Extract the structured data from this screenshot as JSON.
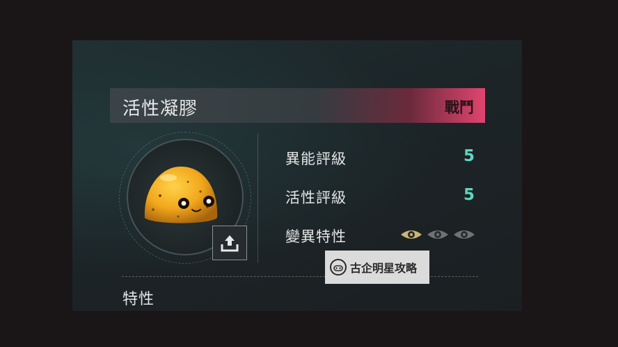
{
  "card": {
    "title": "活性凝膠",
    "category_tag": "戰鬥",
    "accent_color": "#e0456f",
    "value_color": "#5fd6c0"
  },
  "portrait": {
    "creature": "yellow-gel-blob",
    "action_icon": "upload-icon"
  },
  "stats": [
    {
      "label": "異能評級",
      "value": "5"
    },
    {
      "label": "活性評級",
      "value": "5"
    },
    {
      "label": "變異特性",
      "icon": "eye-icon",
      "active_count": 1,
      "total": 3
    }
  ],
  "section": {
    "label": "特性"
  },
  "watermark": {
    "text": "古企明星攻略",
    "icon": "gamepad-icon"
  }
}
